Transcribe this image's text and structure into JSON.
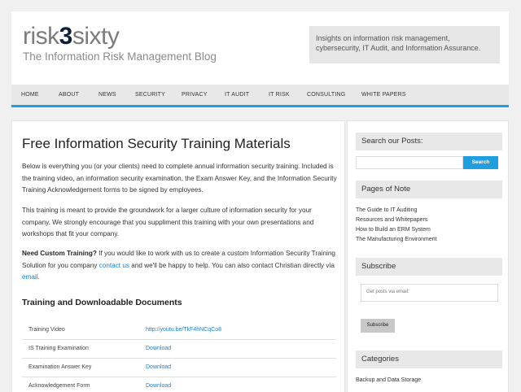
{
  "header": {
    "logo_left": "risk",
    "logo_mid": "3",
    "logo_right": "sixty",
    "tagline": "The Information Risk Management Blog",
    "box_line1": "Insights on information risk management,",
    "box_line2": "cybersecurity, IT Audit, and Information Assurance."
  },
  "nav": {
    "items": [
      "Home",
      "About",
      "News",
      "Security",
      "Privacy",
      "IT Audit",
      "IT Risk",
      "Consulting",
      "White Papers"
    ]
  },
  "post": {
    "title": "Free Information Security Training Materials",
    "p1": "Below is everything you (or your clients) need to complete annual information security training. Included is the training video, an information security examination, the Exam Answer Key, and the Information Security Training Acknowledgement forms to be signed by employees.",
    "p2": "This training is meant to provide the groundwork for a larger culture of information security for your company. We strongly encourage that you suppliment this training with your own presentations and workshops that fit your company.",
    "p3_bold": "Need Custom Training?",
    "p3_a": " If you would like to work with us to create a custom Information Security Training Solution for you company ",
    "p3_link1": "contact us",
    "p3_b": " and we'll be happy to help. You can also contact Christian directly via ",
    "p3_link2": "email",
    "p3_c": ".",
    "section_title": "Training and Downloadable Documents",
    "docs": [
      {
        "label": "Training Video",
        "link": "http://youtu.be/TkF4hNCqCo8"
      },
      {
        "label": "IS Training Examination",
        "link": "Download"
      },
      {
        "label": "Examination Answer Key",
        "link": "Download"
      },
      {
        "label": "Acknowledgement Form",
        "link": "Download"
      }
    ]
  },
  "sidebar": {
    "search_title": "Search our Posts:",
    "search_button": "Search",
    "pages_title": "Pages of Note",
    "pages": [
      "The Guide to IT Auditing",
      "Resources and Whitepapers",
      "How to Build an ERM System",
      "The Manufacturing Environment"
    ],
    "subscribe_title": "Subscribe",
    "subscribe_placeholder": "Get posts via email:",
    "subscribe_button": "Subscribe",
    "categories_title": "Categories",
    "categories": [
      "Backup and Data Storage"
    ]
  },
  "colors": {
    "accent": "#1e9fe0",
    "logo_dark": "#0d2138",
    "link": "#1a7fd0"
  }
}
